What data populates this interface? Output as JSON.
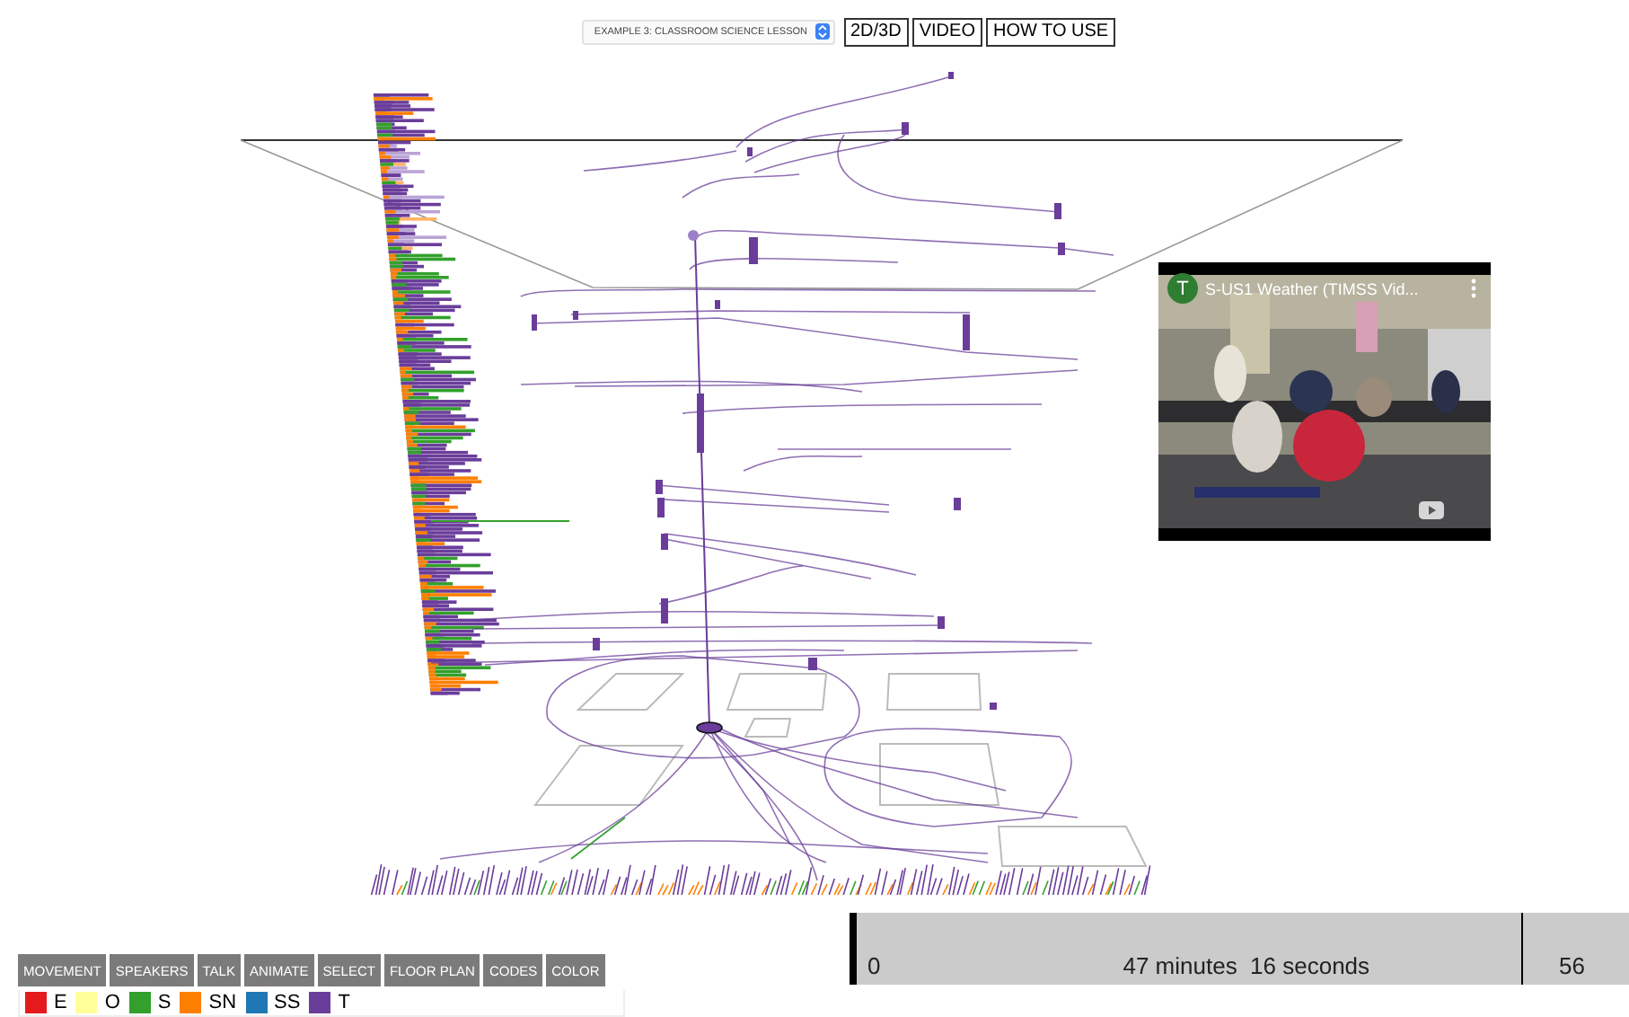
{
  "header": {
    "example_select": {
      "value": "EXAMPLE 3: CLASSROOM SCIENCE LESSON"
    },
    "buttons": [
      {
        "label": "2D/3D"
      },
      {
        "label": "VIDEO"
      },
      {
        "label": "HOW TO USE"
      }
    ]
  },
  "video": {
    "channel_letter": "T",
    "title": "S-US1 Weather (TIMSS Vid..."
  },
  "tabs": [
    {
      "label": "MOVEMENT"
    },
    {
      "label": "SPEAKERS"
    },
    {
      "label": "TALK"
    },
    {
      "label": "ANIMATE"
    },
    {
      "label": "SELECT"
    },
    {
      "label": "FLOOR PLAN"
    },
    {
      "label": "CODES"
    },
    {
      "label": "COLOR"
    }
  ],
  "legend": [
    {
      "label": "E",
      "color": "#e41a1c"
    },
    {
      "label": "O",
      "color": "#ffff99"
    },
    {
      "label": "S",
      "color": "#33a02c"
    },
    {
      "label": "SN",
      "color": "#ff7f00"
    },
    {
      "label": "SS",
      "color": "#1f78b4"
    },
    {
      "label": "T",
      "color": "#6a3d9a"
    }
  ],
  "timeline": {
    "start": "0",
    "current": "47 minutes  16 seconds",
    "end": "56"
  }
}
